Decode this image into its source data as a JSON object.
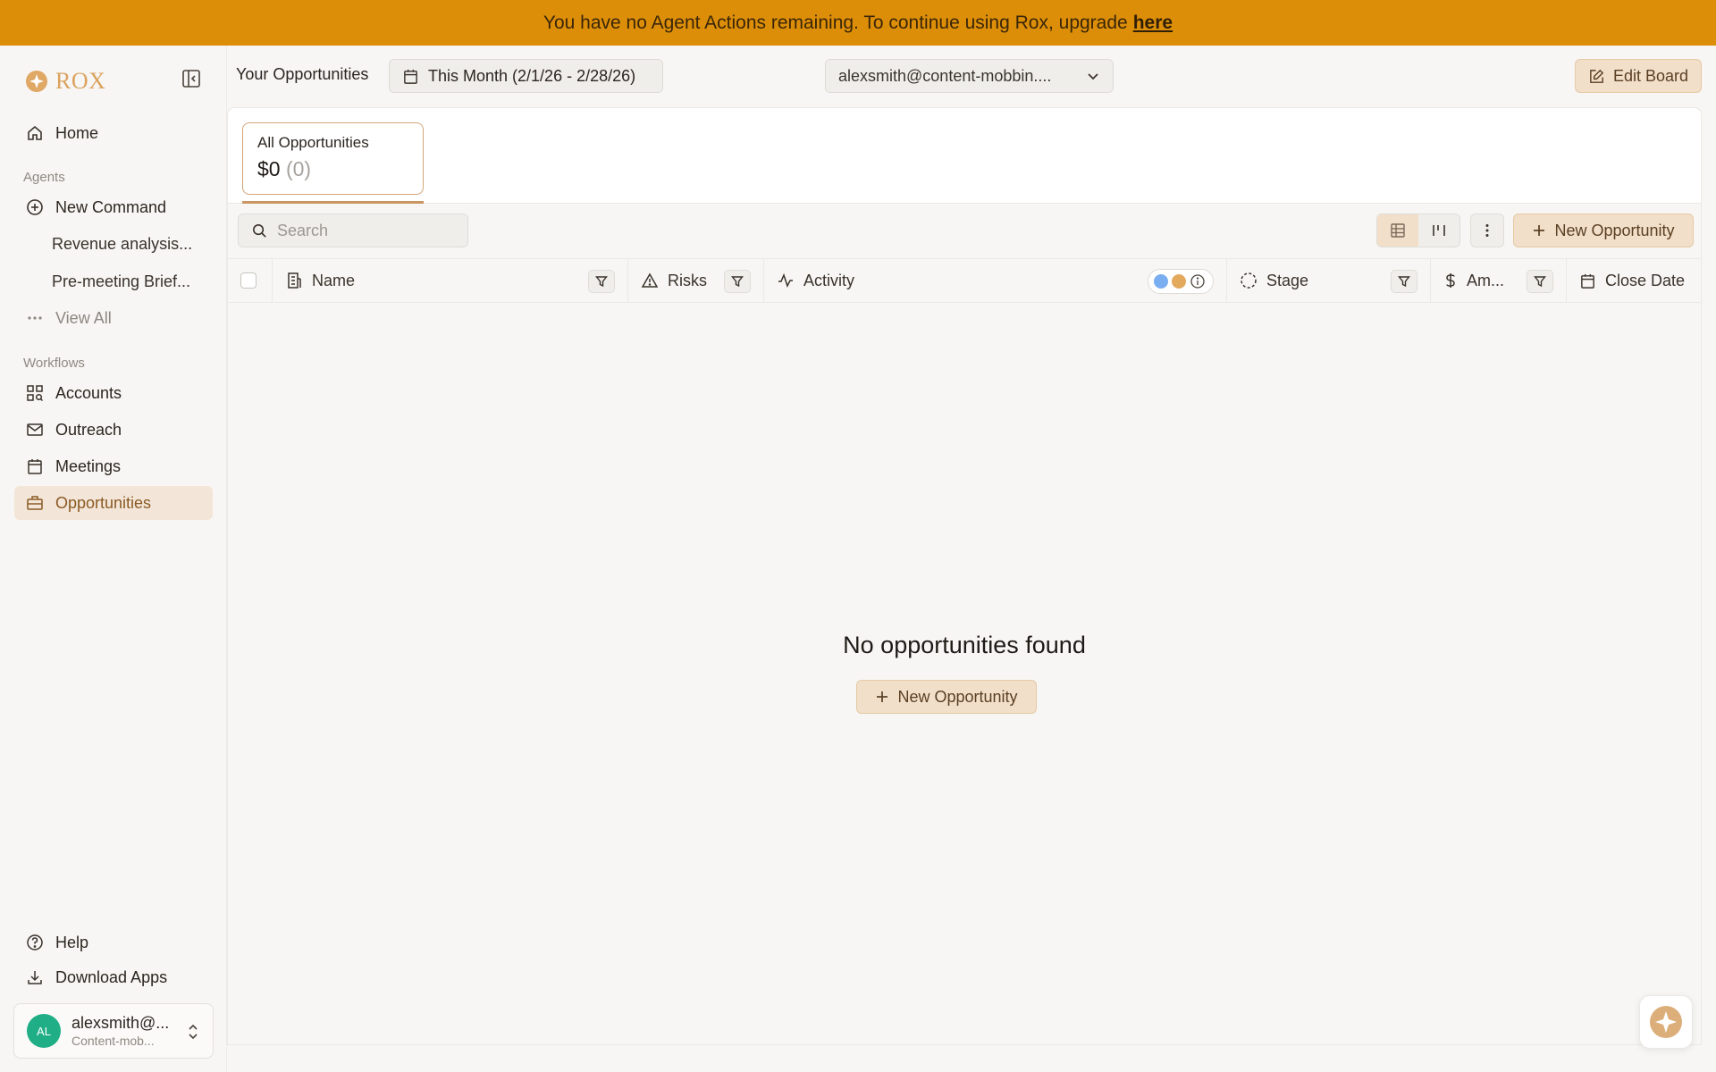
{
  "banner": {
    "message": "You have no Agent Actions remaining. To continue using Rox, upgrade",
    "link_label": "here"
  },
  "brand": {
    "name": "ROX",
    "accent": "#dba25e"
  },
  "sidebar": {
    "home_label": "Home",
    "agents_section": "Agents",
    "agents": [
      {
        "label": "New Command",
        "icon": "plus-circle-icon"
      },
      {
        "label": "Revenue analysis..."
      },
      {
        "label": "Pre-meeting Brief..."
      },
      {
        "label": "View All",
        "icon": "ellipsis-icon"
      }
    ],
    "workflows_section": "Workflows",
    "workflows": [
      {
        "label": "Accounts",
        "icon": "grid-search-icon"
      },
      {
        "label": "Outreach",
        "icon": "mail-icon"
      },
      {
        "label": "Meetings",
        "icon": "calendar-icon"
      },
      {
        "label": "Opportunities",
        "icon": "briefcase-icon",
        "active": true
      }
    ],
    "help_label": "Help",
    "download_label": "Download Apps",
    "user": {
      "initials": "AL",
      "name": "alexsmith@...",
      "org": "Content-mob..."
    }
  },
  "topbar": {
    "title": "Your Opportunities",
    "date_range": "This Month (2/1/26 - 2/28/26)",
    "owner": "alexsmith@content-mobbin....",
    "edit_board": "Edit Board"
  },
  "summary": {
    "label": "All Opportunities",
    "amount": "$0",
    "count": "(0)"
  },
  "toolbar": {
    "search_placeholder": "Search",
    "new_opportunity": "New Opportunity"
  },
  "table": {
    "columns": {
      "name": "Name",
      "risks": "Risks",
      "activity": "Activity",
      "stage": "Stage",
      "amount": "Am...",
      "close_date": "Close Date"
    },
    "legend_colors": [
      "#79aef0",
      "#e3a95c"
    ]
  },
  "empty_state": {
    "title": "No opportunities found",
    "button": "New Opportunity"
  }
}
